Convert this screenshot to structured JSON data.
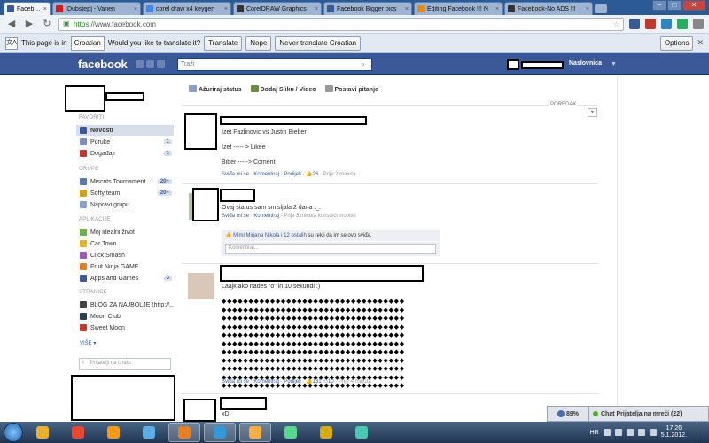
{
  "browser": {
    "tabs": [
      {
        "label": "Facebook",
        "active": true,
        "color": "#3b5998"
      },
      {
        "label": "[Dubstep] - Varien",
        "active": false,
        "color": "#cc1f1f"
      },
      {
        "label": "corel draw x4 keygen",
        "active": false,
        "color": "#4285f4"
      },
      {
        "label": "CorelDRAW Graphics",
        "active": false,
        "color": "#333333"
      },
      {
        "label": "Facebook Bigger pics",
        "active": false,
        "color": "#3b5998"
      },
      {
        "label": "Editing Facebook !!! N",
        "active": false,
        "color": "#e08a1e"
      },
      {
        "label": "Facebook-No ADS !!!",
        "active": false,
        "color": "#333333"
      }
    ],
    "url_scheme": "https://",
    "url_host": "www.facebook.com"
  },
  "translate_bar": {
    "prefix": "This page is in",
    "language": "Croatian",
    "question": "Would you like to translate it?",
    "translate_label": "Translate",
    "nope_label": "Nope",
    "never_label": "Never translate Croatian",
    "options_label": "Options"
  },
  "fb": {
    "logo": "facebook",
    "search_placeholder": "Traži",
    "home_label": "Naslovnica"
  },
  "sidebar": {
    "favorites_header": "FAVORITI",
    "favorites": [
      {
        "label": "Novosti",
        "count": "",
        "color": "#3b5998",
        "selected": true
      },
      {
        "label": "Poruke",
        "count": "1",
        "color": "#7a8fbf",
        "selected": false
      },
      {
        "label": "Događaji",
        "count": "1",
        "color": "#c0392b",
        "selected": false
      }
    ],
    "groups_header": "GRUPE",
    "groups": [
      {
        "label": "Miscrits Tournament...",
        "count": "20+",
        "color": "#5a78b5"
      },
      {
        "label": "Softy team",
        "count": "20+",
        "color": "#d4a017"
      },
      {
        "label": "Napravi grupu",
        "count": "",
        "color": "#8aa0c8"
      }
    ],
    "apps_header": "APLIKACIJE",
    "apps": [
      {
        "label": "Moj idealni život",
        "count": "",
        "color": "#6bb34a"
      },
      {
        "label": "Car Town",
        "count": "",
        "color": "#e2b323"
      },
      {
        "label": "Click Smash",
        "count": "",
        "color": "#9b59b6"
      },
      {
        "label": "Fruit Ninja GAME",
        "count": "",
        "color": "#e67e22"
      },
      {
        "label": "Apps and Games",
        "count": "3",
        "color": "#3b5998"
      }
    ],
    "pages_header": "STRANICE",
    "pages": [
      {
        "label": "BLOG ZA NAJBOLJE (http://...",
        "count": "",
        "color": "#444444"
      },
      {
        "label": "Moon Club",
        "count": "",
        "color": "#2c3e50"
      },
      {
        "label": "Sweet Moon",
        "count": "",
        "color": "#c0392b"
      }
    ],
    "more_label": "VIŠE",
    "chat_search_placeholder": "Prijatelji na chatu"
  },
  "composer": {
    "status": "Ažuriraj status",
    "photo": "Dodaj Sliku / Video",
    "question": "Postavi pitanje"
  },
  "sort_label": "POREDAK",
  "stories": [
    {
      "lines": [
        "Izet Fazlinovic vs Justin Bieber",
        "Izet ----- > Likee",
        "Biber -----> Coment"
      ],
      "like": "Sviđa mi se",
      "comment": "Komentiraj",
      "share": "Podijeli",
      "likes": "26",
      "time": "Prije 2 minuta"
    },
    {
      "lines": [
        "Ovaj status sam smisljala 2 dana ._."
      ],
      "like": "Sviđa mi se",
      "comment": "Komentiraj",
      "time": "Prije 3 minuta koristeći mobitel",
      "likebox_names": "Mimi Mirjana Nikola i 12 ostalih",
      "likebox_rest": "su rekli da im se ovo sviđa.",
      "comment_placeholder": "Komentiraj..."
    },
    {
      "lines": [
        "Laajk ako nađes \"o\" in 10 sekundi :)"
      ],
      "like": "Sviđa mi se",
      "comment": "Komentiraj",
      "share": "Podijeli",
      "likes": "131",
      "comments": "10",
      "time": "Prije 4 minuta",
      "dot_rows": 11
    },
    {
      "lines": [
        "xD"
      ]
    }
  ],
  "chat": {
    "battery": "89%",
    "label": "Chat Prijatelja na mreži (22)"
  },
  "taskbar": {
    "apps": [
      {
        "color": "#e8b031",
        "on": false
      },
      {
        "color": "#e8462f",
        "on": false
      },
      {
        "color": "#f39c12",
        "on": false
      },
      {
        "color": "#5dade2",
        "on": false
      },
      {
        "color": "#e67e22",
        "on": true
      },
      {
        "color": "#3498db",
        "on": true
      },
      {
        "color": "#f5b041",
        "on": true
      },
      {
        "color": "#58d68d",
        "on": false
      },
      {
        "color": "#d4ac0d",
        "on": false
      },
      {
        "color": "#48c9b0",
        "on": false
      }
    ],
    "lang": "HR",
    "time": "17:26",
    "date": "5.1.2012."
  }
}
